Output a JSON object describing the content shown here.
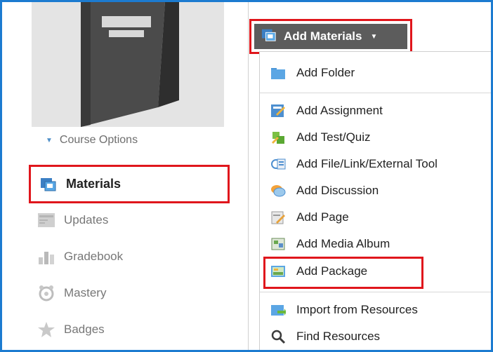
{
  "left_nav": {
    "course_options": "Course Options",
    "items": [
      {
        "label": "Materials",
        "icon": "materials-icon"
      },
      {
        "label": "Updates",
        "icon": "updates-icon"
      },
      {
        "label": "Gradebook",
        "icon": "gradebook-icon"
      },
      {
        "label": "Mastery",
        "icon": "mastery-icon"
      },
      {
        "label": "Badges",
        "icon": "badges-icon"
      }
    ]
  },
  "add_materials": {
    "button_label": "Add Materials",
    "menu": [
      {
        "label": "Add Folder",
        "icon": "folder-icon"
      },
      {
        "label": "Add Assignment",
        "icon": "assignment-icon"
      },
      {
        "label": "Add Test/Quiz",
        "icon": "quiz-icon"
      },
      {
        "label": "Add File/Link/External Tool",
        "icon": "file-link-icon"
      },
      {
        "label": "Add Discussion",
        "icon": "discussion-icon"
      },
      {
        "label": "Add Page",
        "icon": "page-icon"
      },
      {
        "label": "Add Media Album",
        "icon": "media-album-icon"
      },
      {
        "label": "Add Package",
        "icon": "package-icon"
      },
      {
        "label": "Import from Resources",
        "icon": "import-icon"
      },
      {
        "label": "Find Resources",
        "icon": "search-icon"
      }
    ]
  },
  "colors": {
    "highlight_border": "#e0161c",
    "frame_border": "#1c7bd0",
    "button_bg": "#5c5c5c"
  }
}
